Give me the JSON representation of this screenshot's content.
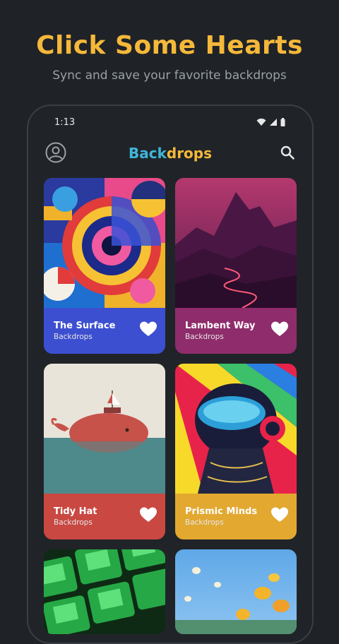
{
  "promo": {
    "headline": "Click Some Hearts",
    "subline": "Sync and save your favorite backdrops"
  },
  "status_bar": {
    "time": "1:13",
    "icons": [
      "wifi-icon",
      "cellular-signal-icon",
      "battery-icon"
    ]
  },
  "app_bar": {
    "title_part1": "Back",
    "title_part2": "drops",
    "left_icon": "account-icon",
    "right_icon": "search-icon"
  },
  "colors": {
    "accent_yellow": "#f5b83a",
    "accent_cyan": "#3fb6d9",
    "background": "#1f2327"
  },
  "cards": [
    {
      "title": "The Surface",
      "subtitle": "Backdrops",
      "caption_color": "#3d4fd1",
      "icon": "heart-icon"
    },
    {
      "title": "Lambent Way",
      "subtitle": "Backdrops",
      "caption_color": "#8f2c6b",
      "icon": "heart-icon"
    },
    {
      "title": "Tidy Hat",
      "subtitle": "Backdrops",
      "caption_color": "#c94842",
      "icon": "heart-icon"
    },
    {
      "title": "Prismic Minds",
      "subtitle": "Backdrops",
      "caption_color": "#e2a830",
      "icon": "heart-icon"
    }
  ]
}
